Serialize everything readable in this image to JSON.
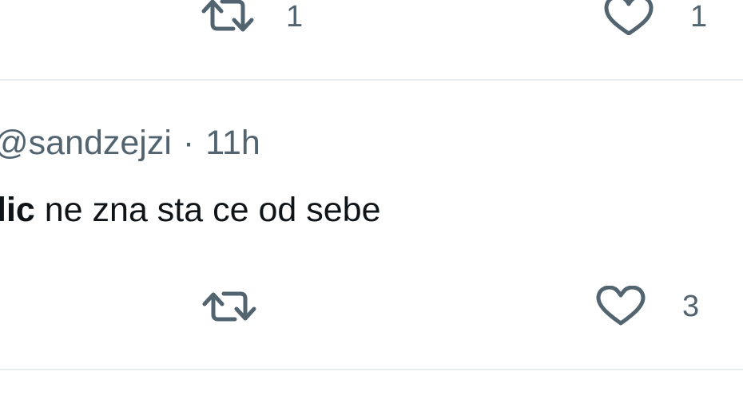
{
  "previous_tweet": {
    "retweet_count": "1",
    "like_count": "1",
    "retweet_icon": "retweet-icon",
    "like_icon": "heart-icon"
  },
  "reply": {
    "handle": "@sandzejzi",
    "separator": "·",
    "time": "11h",
    "mention": "lic",
    "text": " ne zna sta ce od sebe",
    "retweet_count": "",
    "like_count": "3",
    "retweet_icon": "retweet-icon",
    "like_icon": "heart-icon"
  },
  "colors": {
    "text_primary": "#0f1419",
    "text_secondary": "#536471",
    "divider": "#e8ecef",
    "background": "#ffffff"
  }
}
